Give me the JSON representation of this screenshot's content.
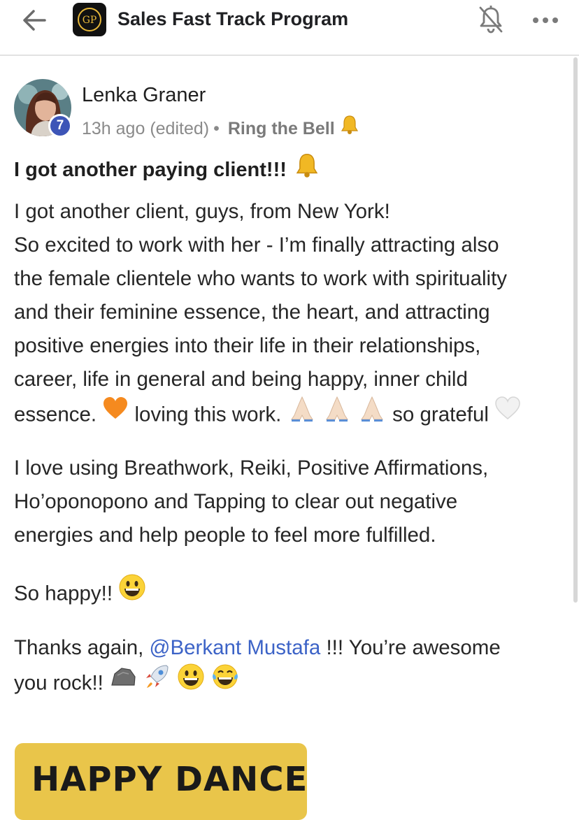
{
  "header": {
    "title": "Sales Fast Track Program",
    "logo_text": "GP",
    "back_icon": "arrow-left-icon",
    "notifications_icon": "bell-off-icon",
    "more_icon": "more-horizontal-icon"
  },
  "post": {
    "author": "Lenka Graner",
    "level": "7",
    "time": "13h ago (edited)",
    "separator": "•",
    "category": "Ring the Bell",
    "title": "I got another paying client!!!",
    "paragraphs": {
      "p1": [
        "I got another client, guys, from New York!",
        "So excited to work with her - I’m finally attracting also",
        "the female clientele who wants to work with spirituality",
        "and their feminine essence, the heart, and attracting",
        "positive energies into their life in their relationships,",
        "career, life in general and being happy, inner child"
      ],
      "p1_last": {
        "a": "essence.",
        "b": "loving this work.",
        "c": "so grateful"
      },
      "p2": [
        "I love using Breathwork, Reiki, Positive Affirmations,",
        "Ho’oponopono and Tapping to clear out negative",
        "energies and help people to feel more fulfilled."
      ],
      "p3": "So happy!!",
      "p4": {
        "pre": "Thanks again,",
        "mention": "@Berkant Mustafa",
        "post": "!!! You’re awesome",
        "line2": "you rock!!"
      }
    },
    "attachment": {
      "text": "HAPPY DANCE"
    }
  },
  "colors": {
    "badge": "#3d55b7",
    "mention": "#3c63c7",
    "gif_background": "#e9c54a"
  }
}
